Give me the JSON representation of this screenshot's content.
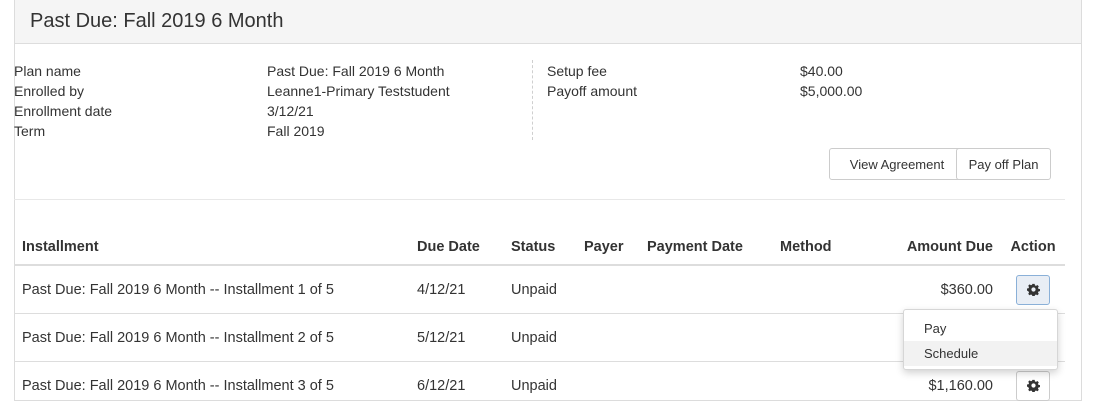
{
  "panel": {
    "title": "Past Due: Fall 2019 6 Month"
  },
  "details_left": {
    "labels": [
      "Plan name",
      "Enrolled by",
      "Enrollment date",
      "Term"
    ],
    "values": [
      "Past Due: Fall 2019 6 Month",
      "Leanne1-Primary Teststudent",
      "3/12/21",
      "Fall 2019"
    ]
  },
  "details_right": {
    "labels": [
      "Setup fee",
      "Payoff amount"
    ],
    "values": [
      "$40.00",
      "$5,000.00"
    ]
  },
  "buttons": {
    "view_agreement": "View Agreement",
    "pay_off_plan": "Pay off Plan"
  },
  "table": {
    "headers": [
      "Installment",
      "Due Date",
      "Status",
      "Payer",
      "Payment Date",
      "Method",
      "Amount Due",
      "Action"
    ],
    "rows": [
      {
        "installment": "Past Due: Fall 2019 6 Month --  Installment 1 of 5",
        "due_date": "4/12/21",
        "status": "Unpaid",
        "payer": "",
        "payment_date": "",
        "method": "",
        "amount_due": "$360.00"
      },
      {
        "installment": "Past Due: Fall 2019 6 Month --  Installment 2 of 5",
        "due_date": "5/12/21",
        "status": "Unpaid",
        "payer": "",
        "payment_date": "",
        "method": "",
        "amount_due": ""
      },
      {
        "installment": "Past Due: Fall 2019 6 Month --  Installment 3 of 5",
        "due_date": "6/12/21",
        "status": "Unpaid",
        "payer": "",
        "payment_date": "",
        "method": "",
        "amount_due": "$1,160.00"
      }
    ]
  },
  "action_menu": {
    "items": [
      "Pay",
      "Schedule"
    ]
  },
  "icons": {
    "action": "gear-icon"
  }
}
